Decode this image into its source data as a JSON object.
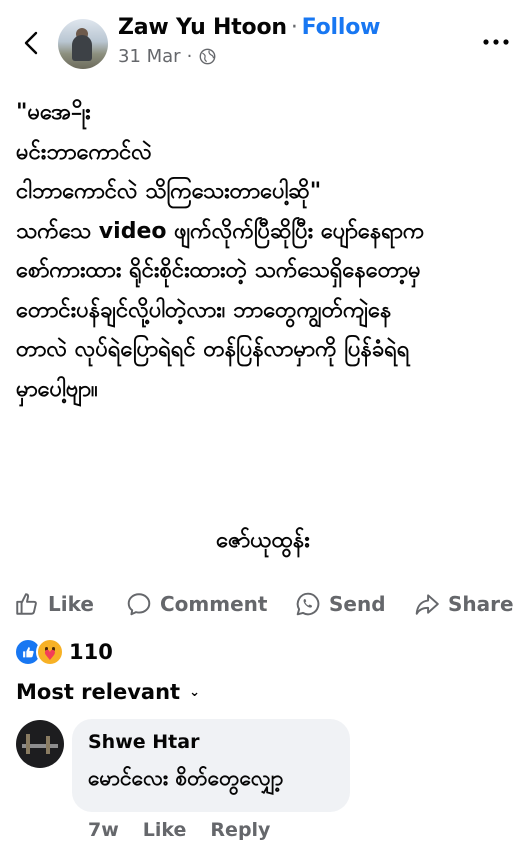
{
  "header": {
    "author": "Zaw Yu Htoon",
    "separator": "·",
    "follow_label": "Follow",
    "date": "31 Mar",
    "date_separator": "·",
    "privacy_icon": "globe-icon",
    "back_icon": "chevron-left-icon",
    "more_icon": "more-horizontal-icon"
  },
  "post": {
    "lines": [
      "\"မအေ-ိုး",
      "မင်းဘာကောင်လဲ",
      "ငါဘာကောင်လဲ သိကြသေးတာပေါ့ဆို\"",
      "သက်သေ video ဖျက်လိုက်ပြီဆိုပြီး ပျော်နေရာက",
      "စော်ကားထား ရိုင်းစိုင်းထားတဲ့ သက်သေရှိနေတော့မှ",
      "တောင်းပန်ချင်လို့ပါတဲ့လား၊ ဘာတွေကျွတ်ကျဲနေ",
      "တာလဲ လုပ်ရဲပြောရဲရင် တန်ပြန်လာမှာကို ပြန်ခံရဲရ",
      "မှာပေါ့ဗျာ။"
    ],
    "signature": "ဇော်ယုထွန်း"
  },
  "actions": {
    "like": "Like",
    "comment": "Comment",
    "send": "Send",
    "share": "Share"
  },
  "reactions": {
    "types": [
      "like",
      "care"
    ],
    "count": "110"
  },
  "comments": {
    "sort_label": "Most relevant",
    "items": [
      {
        "name": "Shwe Htar",
        "text": "မောင်လေး စိတ်တွေလျှော့",
        "time": "7w",
        "like_label": "Like",
        "reply_label": "Reply"
      }
    ]
  },
  "colors": {
    "accent": "#1877f2",
    "secondary_text": "#65676b",
    "bubble_bg": "#f0f2f5"
  }
}
